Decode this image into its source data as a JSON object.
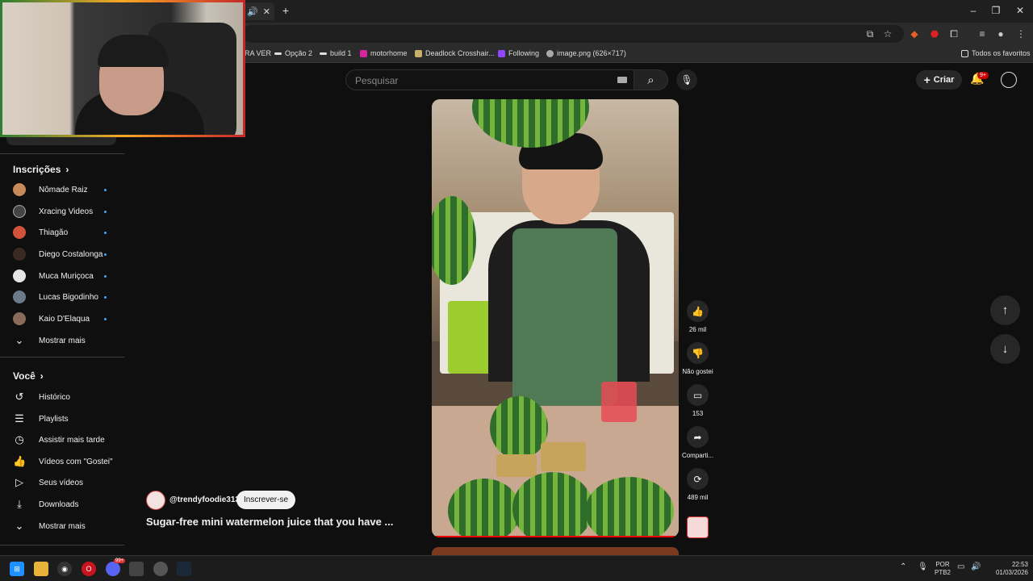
{
  "browser": {
    "bookmarks": [
      {
        "label": "RA VER"
      },
      {
        "label": "Opção 2"
      },
      {
        "label": "build 1"
      },
      {
        "label": "motorhome"
      },
      {
        "label": "Deadlock Crosshair..."
      },
      {
        "label": "Following"
      },
      {
        "label": "image.png (626×717)"
      }
    ],
    "all_bookmarks": "Todos os favoritos"
  },
  "header": {
    "search_placeholder": "Pesquisar",
    "create_label": "Criar",
    "notifications_badge": "9+"
  },
  "sidebar": {
    "subscriptions_title": "Inscrições",
    "subscriptions": [
      {
        "label": "Nômade Raiz",
        "color": "#c98a5a"
      },
      {
        "label": "Xracing Videos",
        "color": "#444444"
      },
      {
        "label": "Thiagão",
        "color": "#d0533a"
      },
      {
        "label": "Diego Costalonga",
        "color": "#3a2a22"
      },
      {
        "label": "Muca Muriçoca",
        "color": "#e6e6e6"
      },
      {
        "label": "Lucas Bigodinho",
        "color": "#6a7a8a"
      },
      {
        "label": "Kaio D'Elaqua",
        "color": "#8a6a5a"
      }
    ],
    "show_more_1": "Mostrar mais",
    "you_title": "Você",
    "you_items": [
      {
        "label": "Histórico",
        "icon": "history-icon"
      },
      {
        "label": "Playlists",
        "icon": "playlist-icon"
      },
      {
        "label": "Assistir mais tarde",
        "icon": "clock-icon"
      },
      {
        "label": "Vídeos com \"Gostei\"",
        "icon": "thumbs-up-icon"
      },
      {
        "label": "Seus vídeos",
        "icon": "video-icon"
      },
      {
        "label": "Downloads",
        "icon": "download-icon"
      }
    ],
    "show_more_2": "Mostrar mais"
  },
  "short": {
    "channel_handle": "@trendyfoodie313",
    "subscribe_label": "Inscrever-se",
    "title": "Sugar-free mini watermelon juice that you have ...",
    "actions": {
      "likes": "26 mil",
      "dislike": "Não gostei",
      "comments": "153",
      "share": "Comparti...",
      "remix": "489 mil"
    }
  },
  "taskbar": {
    "discord_badge": "99+",
    "lang_line1": "POR",
    "lang_line2": "PTB2",
    "time": "22:53",
    "date": "01/03/2026"
  }
}
